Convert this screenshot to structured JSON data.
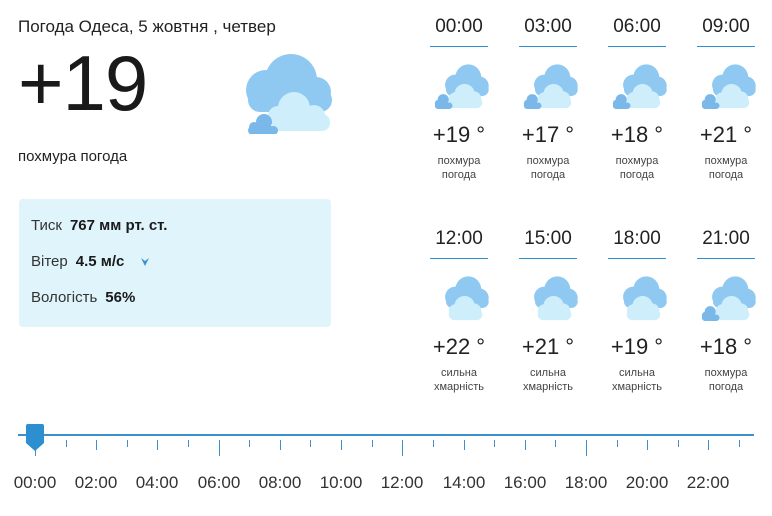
{
  "header": {
    "title": "Погода Одеса, 5 жовтня , четвер"
  },
  "current": {
    "temp": "+19",
    "condition": "похмура погода",
    "icon": "cloudy-icon"
  },
  "details": {
    "pressure_label": "Тиск",
    "pressure_value": "767 мм рт. ст.",
    "wind_label": "Вітер",
    "wind_value": "4.5 м/с",
    "wind_icon": "wind-direction-arrow-icon",
    "humidity_label": "Вологість",
    "humidity_value": "56%"
  },
  "forecast": [
    {
      "time": "00:00",
      "temp": "+19 °",
      "desc1": "похмура",
      "desc2": "погода",
      "icon": "cloudy-icon"
    },
    {
      "time": "03:00",
      "temp": "+17 °",
      "desc1": "похмура",
      "desc2": "погода",
      "icon": "cloudy-icon"
    },
    {
      "time": "06:00",
      "temp": "+18 °",
      "desc1": "похмура",
      "desc2": "погода",
      "icon": "cloudy-icon"
    },
    {
      "time": "09:00",
      "temp": "+21 °",
      "desc1": "похмура",
      "desc2": "погода",
      "icon": "cloudy-icon"
    },
    {
      "time": "12:00",
      "temp": "+22 °",
      "desc1": "сильна",
      "desc2": "хмарність",
      "icon": "heavy-cloud-icon"
    },
    {
      "time": "15:00",
      "temp": "+21 °",
      "desc1": "сильна",
      "desc2": "хмарність",
      "icon": "heavy-cloud-icon"
    },
    {
      "time": "18:00",
      "temp": "+19 °",
      "desc1": "сильна",
      "desc2": "хмарність",
      "icon": "heavy-cloud-icon"
    },
    {
      "time": "21:00",
      "temp": "+18 °",
      "desc1": "похмура",
      "desc2": "погода",
      "icon": "cloudy-icon"
    }
  ],
  "timeline": {
    "labels": [
      "00:00",
      "02:00",
      "04:00",
      "06:00",
      "08:00",
      "10:00",
      "12:00",
      "14:00",
      "16:00",
      "18:00",
      "20:00",
      "22:00"
    ],
    "selected": "00:00",
    "accent": "#2b8fd0"
  },
  "colors": {
    "accent": "#2b8fd0",
    "info_bg": "#dff4fb",
    "cloud_light": "#cdeefa",
    "cloud_blue": "#8fc9f2"
  }
}
